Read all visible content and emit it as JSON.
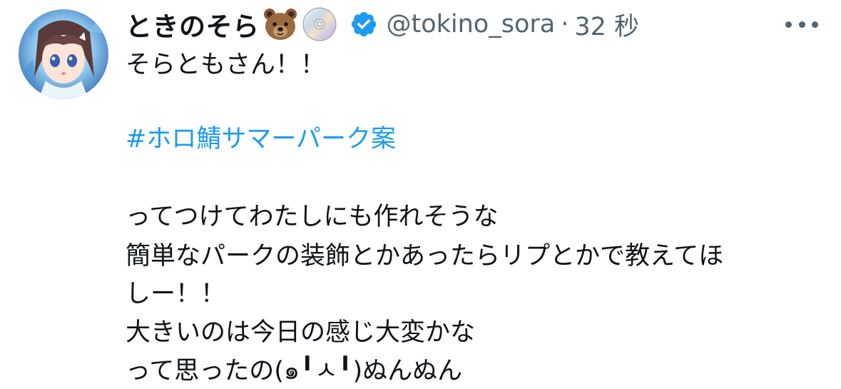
{
  "tweet": {
    "display_name": "ときのそら",
    "handle": "@tokino_sora",
    "separator": "·",
    "time": "32 秒",
    "name_emojis": [
      "bear-face-emoji",
      "optical-disc-emoji"
    ],
    "verified_badge": "verified-badge-icon",
    "more_icon": "more-options-icon",
    "lines": [
      "そらともさん！！",
      "#ホロ鯖サマーパーク案",
      "ってつけてわたしにも作れそうな",
      "簡単なパークの装飾とかあったらリプとかで教えてほ",
      "しー！！",
      "大きいのは今日の感じ大変かな",
      "って思ったの(๑╹ㅅ╹)ぬんぬん"
    ]
  },
  "colors": {
    "text": "#0f1419",
    "secondary": "#536471",
    "link": "#1d9bf0",
    "verified": "#1d9bf0"
  }
}
